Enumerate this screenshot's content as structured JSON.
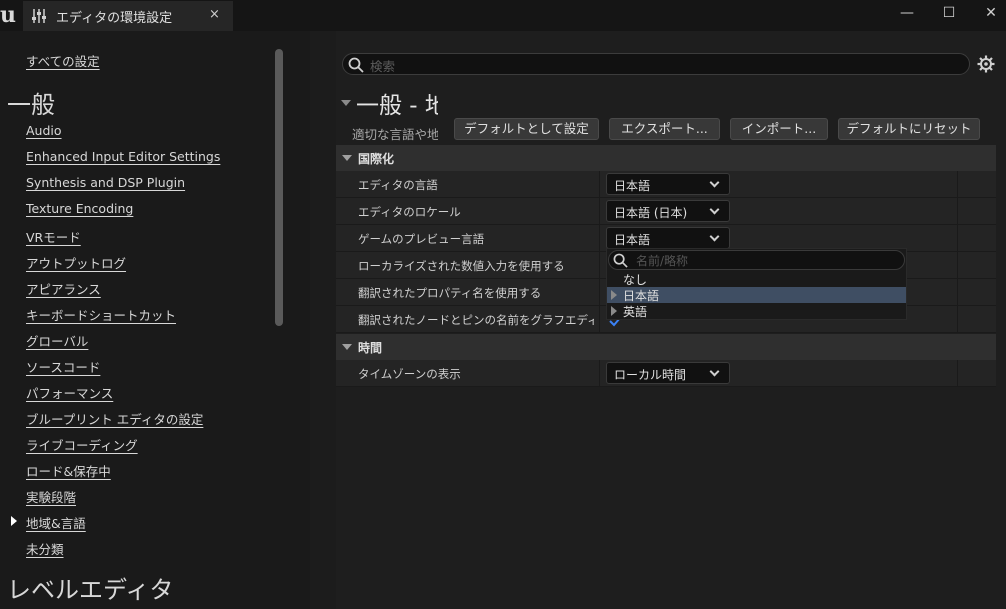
{
  "window": {
    "logo": "u",
    "tab_title": "エディタの環境設定",
    "tab_close": "×",
    "minimize": "—",
    "maximize": "☐",
    "close": "✕"
  },
  "sidebar": {
    "all_settings": "すべての設定",
    "group_general": "一般",
    "items": [
      "Audio",
      "Enhanced Input Editor Settings",
      "Synthesis and DSP Plugin",
      "Texture Encoding",
      "VRモード",
      "アウトプットログ",
      "アピアランス",
      "キーボードショートカット",
      "グローバル",
      "ソースコード",
      "パフォーマンス",
      "ブループリント エディタの設定",
      "ライブコーディング",
      "ロード&保存中",
      "実験段階",
      "地域&言語",
      "未分類"
    ],
    "selected_item": "地域&言語",
    "group_level_editor": "レベルエディタ"
  },
  "main": {
    "search_placeholder": "検索",
    "section_title": "一般 - 地",
    "section_desc": "適切な言語や地",
    "buttons": {
      "set_default": "デフォルトとして設定",
      "export": "エクスポート...",
      "import": "インポート...",
      "reset_default": "デフォルトにリセット"
    },
    "categories": {
      "internationalization": "国際化",
      "time": "時間"
    },
    "rows": {
      "editor_language": "エディタの言語",
      "editor_locale": "エディタのロケール",
      "preview_language": "ゲームのプレビュー言語",
      "localized_numeric": "ローカライズされた数値入力を使用する",
      "translated_props": "翻訳されたプロパティ名を使用する",
      "translated_nodes": "翻訳されたノードとピンの名前をグラフエディタで",
      "timezone": "タイムゾーンの表示"
    },
    "values": {
      "editor_language": "日本語",
      "editor_locale": "日本語 (日本)",
      "preview_language": "日本語",
      "timezone": "ローカル時間"
    },
    "translated_nodes_checked": true
  },
  "dropdown": {
    "search_placeholder": "名前/略称",
    "options": [
      "なし",
      "日本語",
      "英語"
    ],
    "selected": "日本語"
  },
  "colors": {
    "accent_selection": "#3f4e63",
    "check": "#3b82f6"
  }
}
